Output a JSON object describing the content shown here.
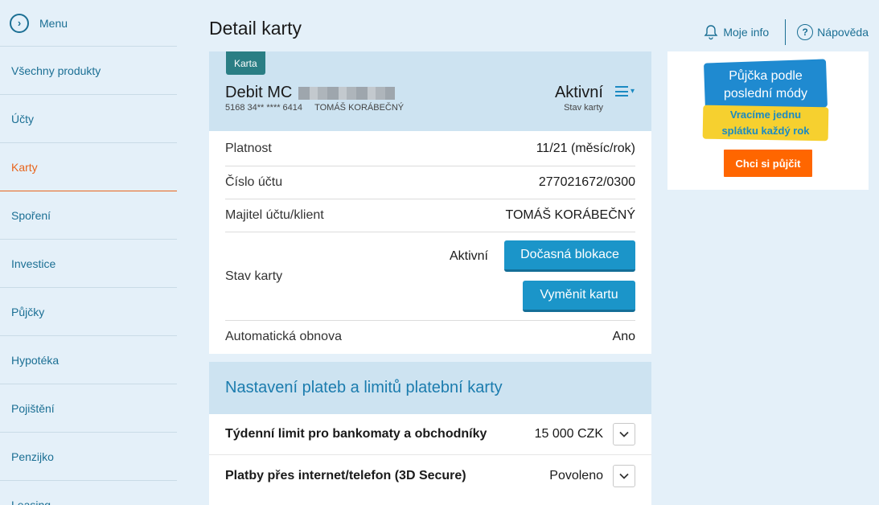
{
  "sidebar": {
    "menu_label": "Menu",
    "items": [
      {
        "label": "Všechny produkty"
      },
      {
        "label": "Účty"
      },
      {
        "label": "Karty"
      },
      {
        "label": "Spoření"
      },
      {
        "label": "Investice"
      },
      {
        "label": "Půjčky"
      },
      {
        "label": "Hypotéka"
      },
      {
        "label": "Pojištění"
      },
      {
        "label": "Penzijko"
      },
      {
        "label": "Leasing"
      }
    ],
    "active": "Karty"
  },
  "header": {
    "title": "Detail karty",
    "moje_info": "Moje info",
    "help": "Nápověda"
  },
  "card": {
    "tag": "Karta",
    "name": "Debit MC",
    "number": "5168 34** **** 6414",
    "holder": "TOMÁŠ KORÁBEČNÝ",
    "status": "Aktivní",
    "status_caption": "Stav karty"
  },
  "details": {
    "validity_label": "Platnost",
    "validity_value": "11/21 (měsíc/rok)",
    "account_label": "Číslo účtu",
    "account_value": "277021672/0300",
    "owner_label": "Majitel účtu/klient",
    "owner_value": "TOMÁŠ KORÁBEČNÝ",
    "state_label": "Stav karty",
    "state_value": "Aktivní",
    "block_button": "Dočasná blokace",
    "replace_button": "Vyměnit kartu",
    "renewal_label": "Automatická obnova",
    "renewal_value": "Ano"
  },
  "payments": {
    "heading": "Nastavení plateb a limitů platební karty",
    "rows": [
      {
        "label": "Týdenní limit pro bankomaty a obchodníky",
        "value": "15 000 CZK"
      },
      {
        "label": "Platby přes internet/telefon (3D Secure)",
        "value": "Povoleno"
      }
    ]
  },
  "ad": {
    "line1": "Půjčka podle",
    "line2": "poslední módy",
    "line3": "Vracíme jednu",
    "line4": "splátku každý rok",
    "button": "Chci si půjčit",
    "colors": {
      "blue": "#1f8ad0",
      "yellow": "#f6d02f",
      "button": "#ff6600"
    }
  },
  "colors": {
    "accent": "#1b6f94",
    "active": "#e8641c",
    "primary_button": "#1b95c9"
  }
}
